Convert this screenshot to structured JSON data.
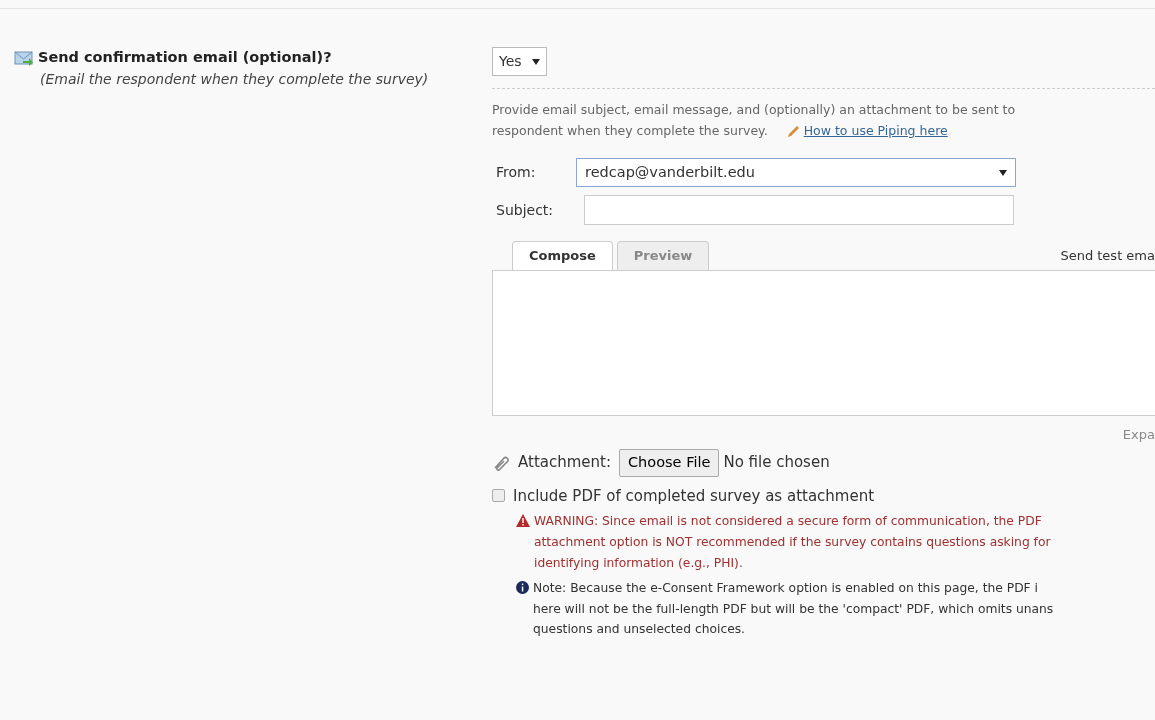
{
  "question": {
    "title": "Send confirmation email (optional)?",
    "subtitle": "(Email the respondent when they complete the survey)"
  },
  "enable_select": {
    "value": "Yes"
  },
  "instructions": {
    "text": "Provide email subject, email message, and (optionally) an attachment to be sent to respondent when they complete the survey.",
    "link": "How to use Piping here"
  },
  "from": {
    "label": "From:",
    "value": "redcap@vanderbilt.edu"
  },
  "subject": {
    "label": "Subject:"
  },
  "tabs": [
    {
      "label": "Compose",
      "selected": true
    },
    {
      "label": "Preview",
      "selected": false
    }
  ],
  "send_test": "Send test ema",
  "expand": "Expa",
  "attachment": {
    "label": "Attachment:",
    "button": "Choose File",
    "status": "No file chosen"
  },
  "include_pdf": {
    "label": "Include PDF of completed survey as attachment",
    "checked": false
  },
  "warning_lines": [
    "WARNING: Since email is not considered a secure form of communication, the PDF",
    "attachment option is NOT recommended if the survey contains questions asking for",
    "identifying information (e.g., PHI)."
  ],
  "note_lines": [
    "Note: Because the e-Consent Framework option is enabled on this page, the PDF i",
    "here will not be the full-length PDF but will be the 'compact' PDF, which omits unans",
    "questions and unselected choices."
  ]
}
